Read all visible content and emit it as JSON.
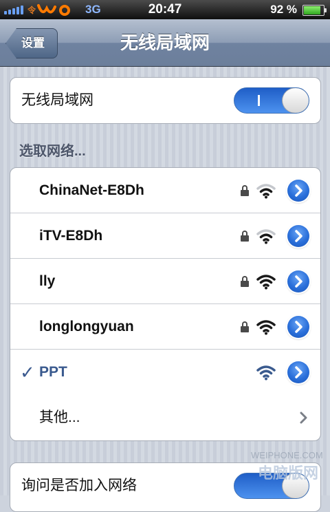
{
  "status_bar": {
    "network_type": "3G",
    "time": "20:47",
    "battery_percent": "92 %",
    "battery_level": 0.92,
    "signal_icon": "signal-bars-icon",
    "carrier_icon": "carrier-logo-icon"
  },
  "nav": {
    "back_label": "设置",
    "title": "无线局域网"
  },
  "wifi_toggle": {
    "label": "无线局域网",
    "state": "on",
    "accent": "#2f74dd"
  },
  "section": {
    "header": "选取网络..."
  },
  "networks": [
    {
      "name": "ChinaNet-E8Dh",
      "locked": true,
      "signal": 2,
      "connected": false
    },
    {
      "name": "iTV-E8Dh",
      "locked": true,
      "signal": 2,
      "connected": false
    },
    {
      "name": "lly",
      "locked": true,
      "signal": 3,
      "connected": false
    },
    {
      "name": "longlongyuan",
      "locked": true,
      "signal": 3,
      "connected": false
    },
    {
      "name": "PPT",
      "locked": false,
      "signal": 3,
      "connected": true,
      "check": "✓"
    }
  ],
  "other": {
    "label": "其他..."
  },
  "ask_join": {
    "label": "询问是否加入网络"
  },
  "watermark": {
    "text1": "WEIPHONE.COM",
    "text2": "电脑版网"
  }
}
